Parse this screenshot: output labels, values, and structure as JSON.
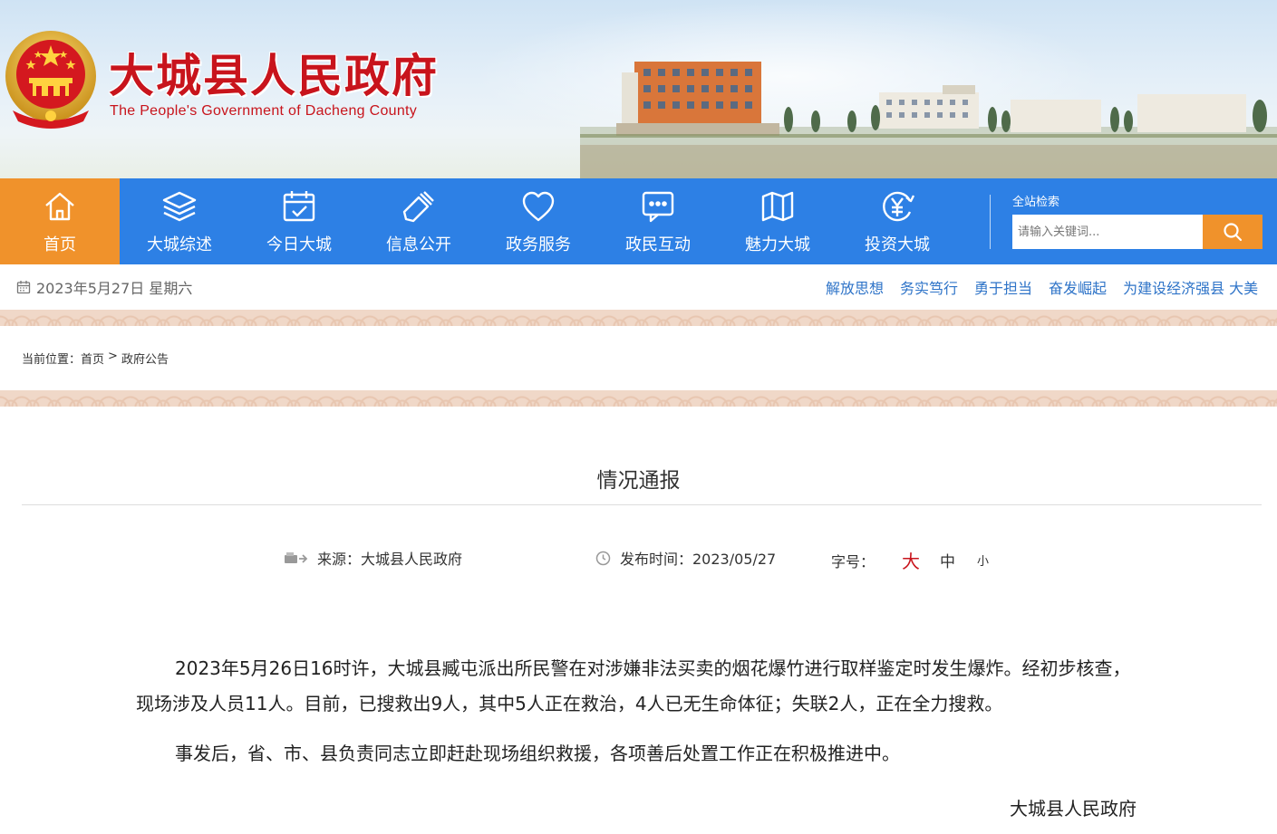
{
  "header": {
    "title": "大城县人民政府",
    "subtitle": "The People's Government of Dacheng County"
  },
  "nav": {
    "items": [
      {
        "label": "首页",
        "icon": "home-icon"
      },
      {
        "label": "大城综述",
        "icon": "layers-icon"
      },
      {
        "label": "今日大城",
        "icon": "calendar-check-icon"
      },
      {
        "label": "信息公开",
        "icon": "tools-icon"
      },
      {
        "label": "政务服务",
        "icon": "heart-icon"
      },
      {
        "label": "政民互动",
        "icon": "chat-icon"
      },
      {
        "label": "魅力大城",
        "icon": "map-icon"
      },
      {
        "label": "投资大城",
        "icon": "yuan-icon"
      }
    ],
    "active_index": 0,
    "search_label": "全站检索",
    "search_placeholder": "请输入关键词..."
  },
  "datebar": {
    "date": "2023年5月27日 星期六",
    "slogans": [
      "解放思想",
      "务实笃行",
      "勇于担当",
      "奋发崛起",
      "为建设经济强县 大美"
    ]
  },
  "breadcrumb": {
    "prefix": "当前位置：",
    "home": "首页",
    "separator": ">",
    "current": "政府公告"
  },
  "article": {
    "title": "情况通报",
    "source": "来源：大城县人民政府",
    "publish_time": "发布时间：2023/05/27",
    "font_size_label": "字号：",
    "font_size_large": "大",
    "font_size_medium": "中",
    "font_size_small": "小",
    "paragraphs": [
      "2023年5月26日16时许，大城县臧屯派出所民警在对涉嫌非法买卖的烟花爆竹进行取样鉴定时发生爆炸。经初步核查，现场涉及人员11人。目前，已搜救出9人，其中5人正在救治，4人已无生命体征；失联2人，正在全力搜救。",
      "事发后，省、市、县负责同志立即赶赴现场组织救援，各项善后处置工作正在积极推进中。"
    ],
    "signature": "大城县人民政府"
  },
  "colors": {
    "nav_blue": "#2d80e5",
    "accent_orange": "#f0922b",
    "title_red": "#c8141c",
    "slogan_blue": "#2f74c8"
  }
}
